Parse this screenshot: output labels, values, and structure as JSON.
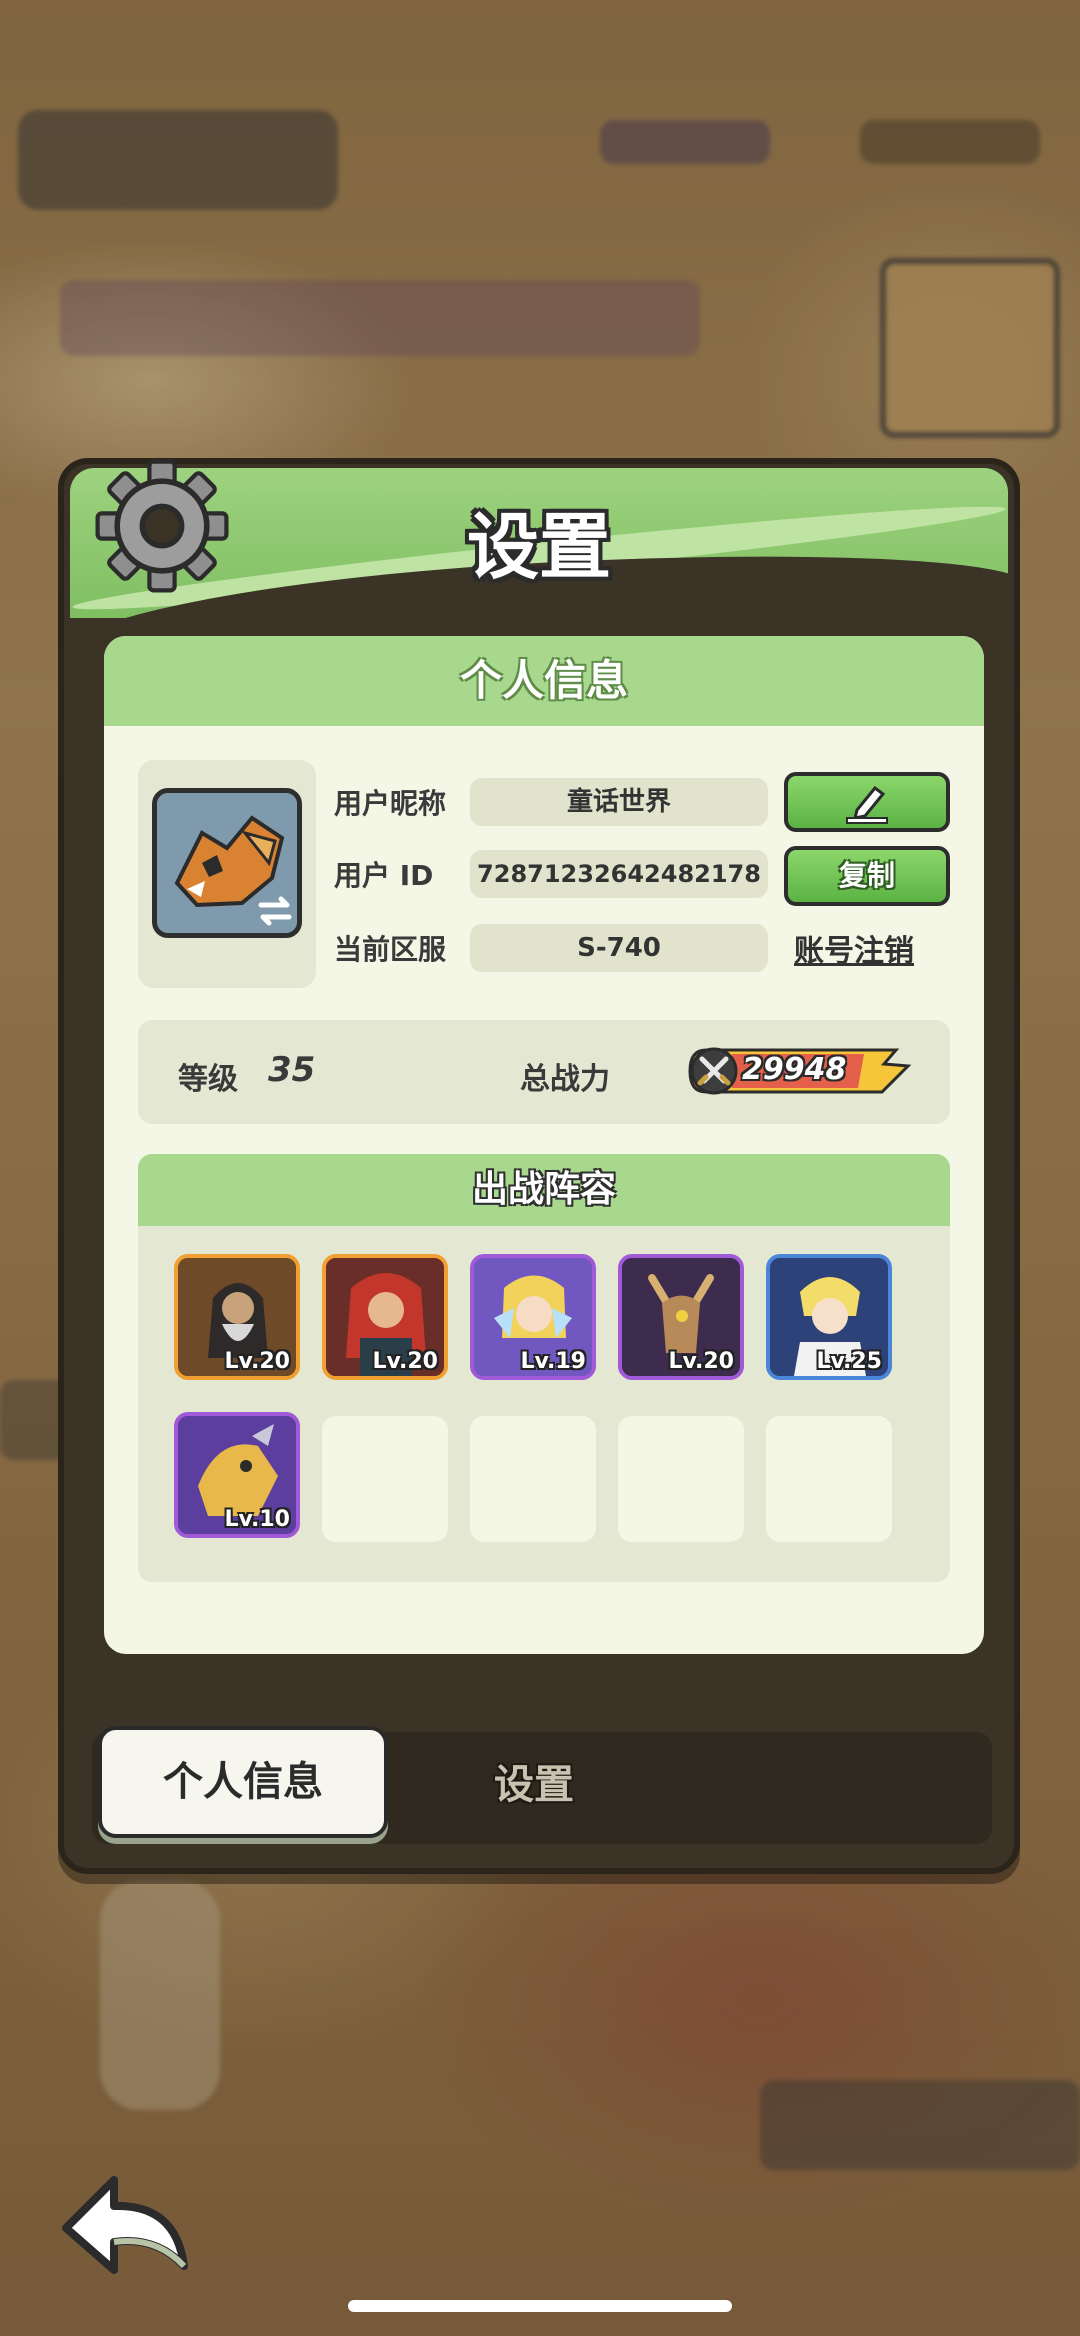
{
  "dialog": {
    "title": "设置"
  },
  "panel": {
    "title": "个人信息"
  },
  "profile": {
    "nickname_label": "用户昵称",
    "nickname_value": "童话世界",
    "id_label": "用户 ID",
    "id_value": "7287123264248217​8",
    "server_label": "当前区服",
    "server_value": "S-740",
    "copy_button": "复制",
    "cancel_account_link": "账号注销"
  },
  "stats": {
    "level_label": "等级",
    "level_value": "35",
    "power_label": "总战力",
    "power_value": "29948"
  },
  "team": {
    "title": "出战阵容",
    "heroes": [
      {
        "level": "Lv.20",
        "frame_color": "#f0a030"
      },
      {
        "level": "Lv.20",
        "frame_color": "#f0a030"
      },
      {
        "level": "Lv.19",
        "frame_color": "#a05ad8"
      },
      {
        "level": "Lv.20",
        "frame_color": "#a05ad8"
      },
      {
        "level": "Lv.25",
        "frame_color": "#4a86d8"
      },
      {
        "level": "Lv.10",
        "frame_color": "#a05ad8"
      }
    ],
    "empty_slots": 4
  },
  "tabs": {
    "active": "个人信息",
    "inactive": "设置"
  },
  "icons": [
    "gear-icon",
    "edit-pencil-icon",
    "swap-avatar-icon",
    "crossed-swords-icon",
    "back-arrow-icon"
  ]
}
